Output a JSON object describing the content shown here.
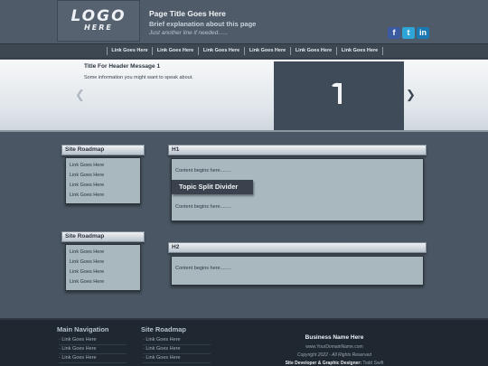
{
  "header": {
    "logo_main": "LOGO",
    "logo_sub": "HERE",
    "page_title": "Page Title Goes Here",
    "subtitle": "Brief explanation about this page",
    "extra_line": "Just another line if needed......",
    "social": [
      {
        "name": "facebook",
        "glyph": "f",
        "color": "#3b5aa0"
      },
      {
        "name": "twitter",
        "glyph": "t",
        "color": "#2fa4d6"
      },
      {
        "name": "linkedin",
        "glyph": "in",
        "color": "#1c78b3"
      }
    ]
  },
  "nav": {
    "items": [
      "Link Goes Here",
      "Link Goes Here",
      "Link Goes Here",
      "Link Goes Here",
      "Link Goes Here",
      "Link Goes Here"
    ]
  },
  "banner": {
    "title": "Title For Header Message 1",
    "text": "Some information you might want to speak about.",
    "prev_icon": "chevron-left-icon",
    "next_icon": "chevron-right-icon"
  },
  "sidebar": {
    "boxes": [
      {
        "title": "Site Roadmap",
        "links": [
          "Link Goes Here",
          "Link Goes Here",
          "Link Goes Here",
          "Link Goes Here"
        ]
      },
      {
        "title": "Site Roadmap",
        "links": [
          "Link Goes Here",
          "Link Goes Here",
          "Link Goes Here",
          "Link Goes Here"
        ]
      }
    ]
  },
  "main": {
    "section1": {
      "heading": "H1",
      "content_top": "Content begins here........",
      "divider": "Topic Split Divider",
      "content_bottom": "Content begins here........"
    },
    "section2": {
      "heading": "H2",
      "content": "Content begins here........"
    }
  },
  "footer": {
    "main_nav_title": "Main Navigation",
    "main_nav_links": [
      "Link Goes Here",
      "Link Goes Here",
      "Link Goes Here"
    ],
    "roadmap_title": "Site Roadmap",
    "roadmap_links": [
      "Link Goes Here",
      "Link Goes Here",
      "Link Goes Here"
    ],
    "business_name": "Business Name Here",
    "domain": "www.YourDomainName.com",
    "copyright": "Copyright 2022 - All Rights Reserved",
    "developer_label": "Site Developer & Graphic Designer:",
    "developer_name": "Todd Swift"
  },
  "colors": {
    "background": "#4a5663",
    "footer": "#1f2730",
    "panel": "#a9b7bf",
    "divider": "#3a434d"
  }
}
